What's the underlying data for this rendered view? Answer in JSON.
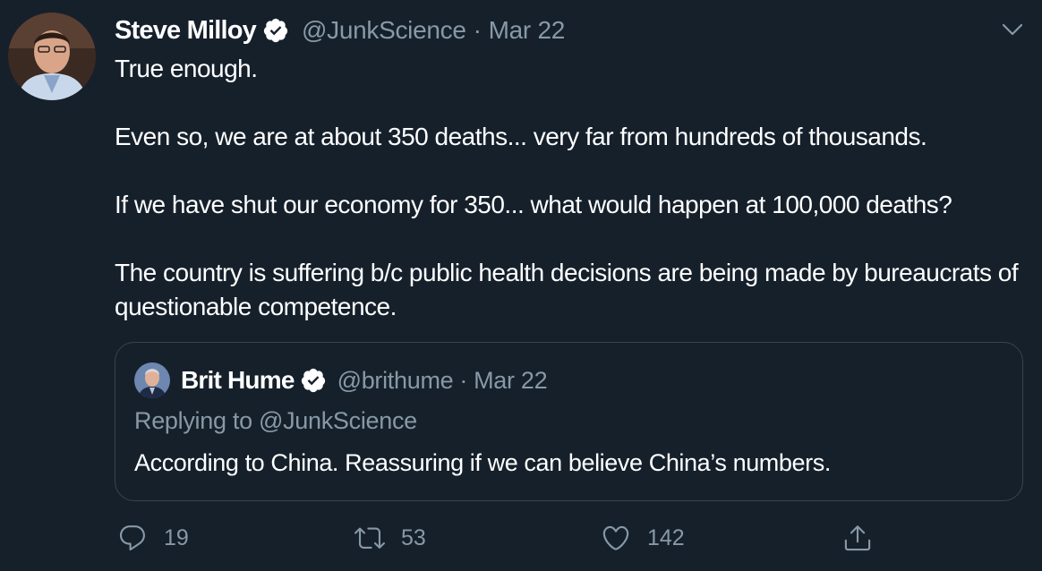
{
  "tweet": {
    "author_name": "Steve Milloy",
    "author_handle": "@JunkScience",
    "separator": "·",
    "date": "Mar 22",
    "paragraphs": [
      "True enough.",
      "Even so, we are at about 350 deaths... very far from hundreds of thousands.",
      "If we have shut our economy for 350... what would happen at 100,000 deaths?",
      "The country is suffering b/c public health decisions are being made by bureaucrats of questionable competence."
    ]
  },
  "quoted_tweet": {
    "author_name": "Brit Hume",
    "author_handle": "@brithume",
    "separator": "·",
    "date": "Mar 22",
    "reply_context": "Replying to @JunkScience",
    "text": "According to China. Reassuring if we can believe China’s numbers."
  },
  "actions": {
    "reply_count": "19",
    "retweet_count": "53",
    "like_count": "142"
  },
  "icons": {
    "verified": "verified-badge-icon",
    "menu": "chevron-down-icon",
    "reply": "reply-bubble-icon",
    "retweet": "retweet-icon",
    "like": "heart-icon",
    "share": "share-icon"
  },
  "colors": {
    "background": "#15202b",
    "secondary_text": "#8899a6",
    "border": "#38444d",
    "verified": "#ffffff"
  }
}
